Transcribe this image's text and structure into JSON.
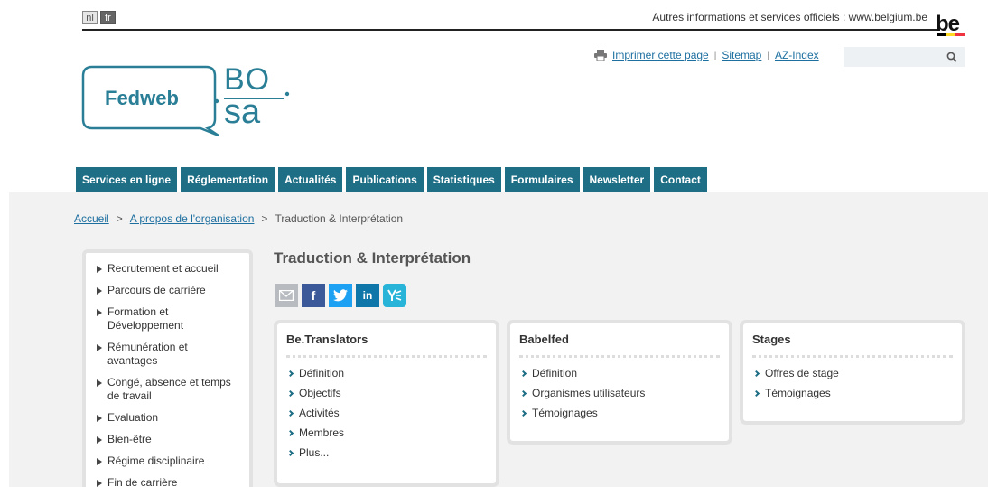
{
  "header": {
    "lang_nl": "nl",
    "lang_fr": "fr",
    "gov_text": "Autres informations et services officiels : www.belgium.be",
    "be_logo": "be",
    "print_label": "Imprimer cette page",
    "sitemap_label": "Sitemap",
    "azindex_label": "AZ-Index",
    "search_placeholder": ""
  },
  "logo": {
    "left_text": "Fedweb",
    "right_top": "BO",
    "right_bottom": "sa"
  },
  "nav": [
    "Services en ligne",
    "Réglementation",
    "Actualités",
    "Publications",
    "Statistiques",
    "Formulaires",
    "Newsletter",
    "Contact"
  ],
  "breadcrumb": {
    "home": "Accueil",
    "parent": "A propos de l'organisation",
    "current": "Traduction & Interprétation",
    "sep": ">"
  },
  "sidebar": [
    "Recrutement et accueil",
    "Parcours de carrière",
    "Formation et Développement",
    "Rémunération et avantages",
    "Congé, absence et temps de travail",
    "Evaluation",
    "Bien-être",
    "Régime disciplinaire",
    "Fin de carrière"
  ],
  "page_title": "Traduction & Interprétation",
  "social": {
    "fb": "f",
    "in": "in"
  },
  "cards": [
    {
      "title": "Be.Translators",
      "items": [
        "Définition",
        "Objectifs",
        "Activités",
        "Membres",
        "Plus..."
      ]
    },
    {
      "title": "Babelfed",
      "items": [
        "Définition",
        "Organismes utilisateurs",
        "Témoignages"
      ]
    },
    {
      "title": "Stages",
      "items": [
        "Offres de stage",
        "Témoignages"
      ]
    }
  ],
  "colors": {
    "nav_bg": "#1e6e86",
    "link": "#1d6fa0",
    "logo_teal": "#2a7f97"
  }
}
